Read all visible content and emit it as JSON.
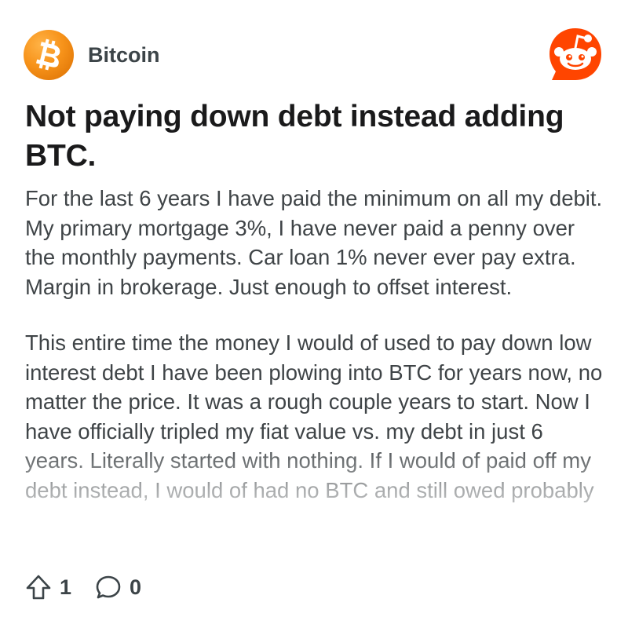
{
  "subreddit": {
    "name": "Bitcoin",
    "icon": "bitcoin-b-icon",
    "accent": "#f7931a"
  },
  "brand": {
    "icon": "reddit-snoo-icon",
    "color": "#ff4500"
  },
  "post": {
    "title": "Not paying down debt instead adding BTC.",
    "paragraphs": [
      "For the last 6 years I have paid the minimum on all my debit. My primary mortgage 3%, I have never paid a penny over the monthly payments. Car loan 1% never ever pay extra. Margin in brokerage. Just enough to offset interest.",
      "This entire time the money I would of used to pay down low interest debt I have been plowing into BTC for years now, no matter the price. It was a rough couple years to start. Now I have officially tripled my fiat value vs. my debt in just 6 years. Literally started with nothing. If I would of paid off my debt instead, I would of had no BTC and still owed probably"
    ]
  },
  "actions": {
    "upvote": {
      "icon": "upvote-arrow-icon",
      "count": "1"
    },
    "comments": {
      "icon": "comment-bubble-icon",
      "count": "0"
    }
  }
}
